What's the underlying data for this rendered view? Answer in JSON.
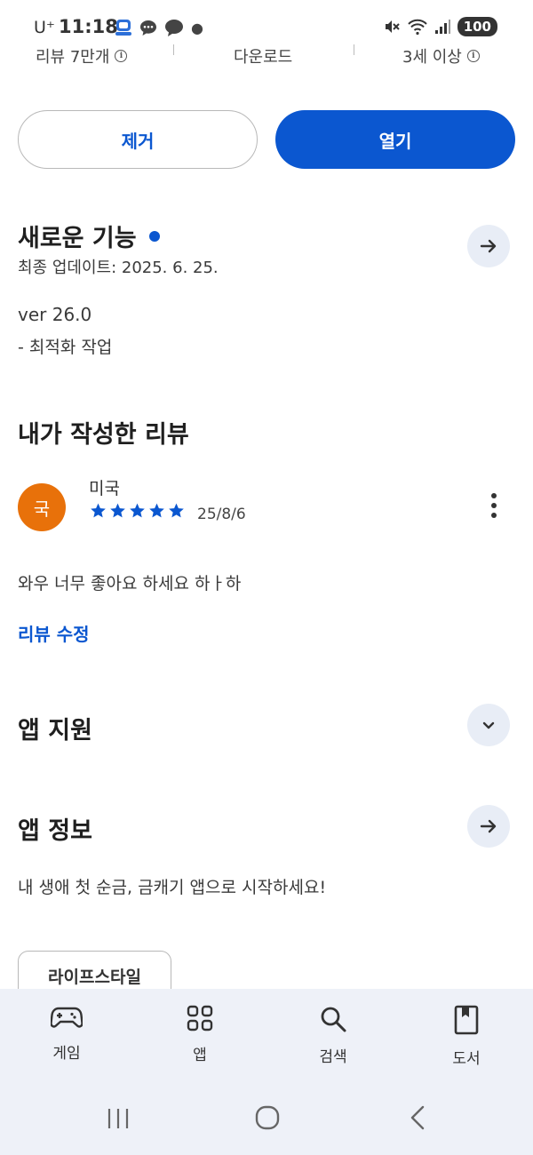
{
  "status_bar": {
    "carrier": "U⁺",
    "time": "11:18",
    "battery": "100"
  },
  "meta": {
    "reviews": "리뷰 7만개",
    "downloads": "다운로드",
    "age_rating": "3세 이상"
  },
  "actions": {
    "remove_label": "제거",
    "open_label": "열기"
  },
  "whats_new": {
    "title": "새로운 기능",
    "updated": "최종 업데이트: 2025. 6. 25.",
    "version": "ver 26.0",
    "notes": "- 최적화 작업"
  },
  "my_review": {
    "title": "내가 작성한 리뷰",
    "avatar_letter": "국",
    "author": "미국",
    "rating": 5,
    "date": "25/8/6",
    "text": "와우 너무 좋아요 하세요 하ㅏ하",
    "edit_label": "리뷰 수정"
  },
  "app_support": {
    "title": "앱 지원"
  },
  "app_info": {
    "title": "앱 정보",
    "description": "내 생애 첫 순금, 금캐기 앱으로 시작하세요!",
    "category_chip": "라이프스타일"
  },
  "bottom_nav": {
    "items": [
      {
        "label": "게임",
        "icon": "gamepad-icon"
      },
      {
        "label": "앱",
        "icon": "apps-grid-icon"
      },
      {
        "label": "검색",
        "icon": "search-icon"
      },
      {
        "label": "도서",
        "icon": "book-icon"
      }
    ]
  },
  "colors": {
    "accent": "#0b57d0",
    "avatar": "#e8710a",
    "nav_background": "#eef1f8"
  }
}
